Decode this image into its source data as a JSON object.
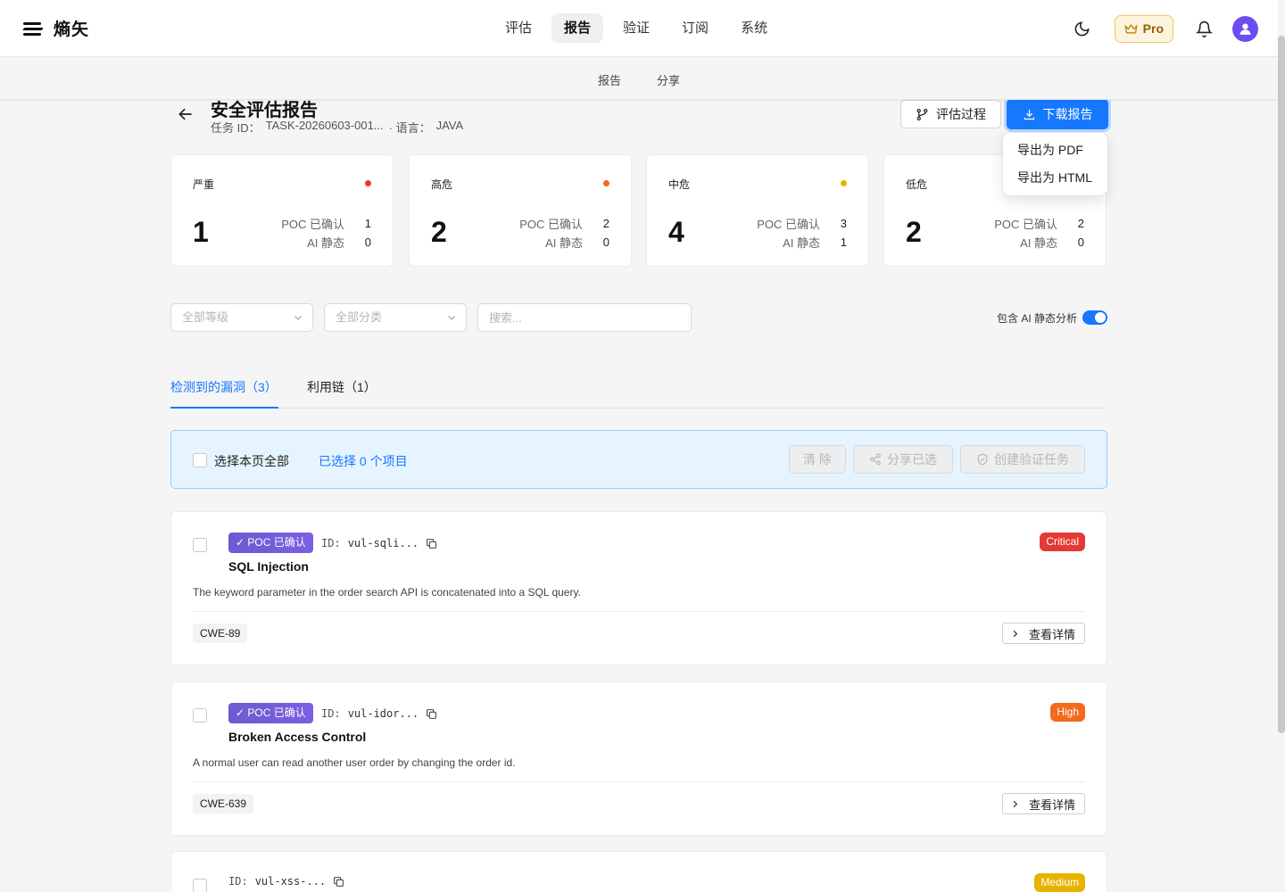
{
  "app": {
    "name": "熵矢",
    "pro_label": "Pro"
  },
  "nav": {
    "items": [
      "评估",
      "报告",
      "验证",
      "订阅",
      "系统"
    ],
    "active": 1
  },
  "subnav": {
    "items": [
      "报告",
      "分享"
    ]
  },
  "header": {
    "title": "安全评估报告",
    "task_label": "任务 ID：",
    "task_value": "TASK-20260603-001...",
    "lang_label": "· 语言：",
    "lang_value": "JAVA",
    "process_button": "评估过程",
    "download_button": "下载报告"
  },
  "download_menu": [
    "导出为 PDF",
    "导出为 HTML"
  ],
  "stats": [
    {
      "label": "严重",
      "count": "1",
      "poc_label": "POC 已确认",
      "poc": "1",
      "ai_label": "AI 静态",
      "ai": "0",
      "color": "#e53935"
    },
    {
      "label": "高危",
      "count": "2",
      "poc_label": "POC 已确认",
      "poc": "2",
      "ai_label": "AI 静态",
      "ai": "0",
      "color": "#f26b1d"
    },
    {
      "label": "中危",
      "count": "4",
      "poc_label": "POC 已确认",
      "poc": "3",
      "ai_label": "AI 静态",
      "ai": "1",
      "color": "#e6b400"
    },
    {
      "label": "低危",
      "count": "2",
      "poc_label": "POC 已确认",
      "poc": "2",
      "ai_label": "AI 静态",
      "ai": "0",
      "color": "#4caf50"
    }
  ],
  "filters": {
    "level_placeholder": "全部等级",
    "category_placeholder": "全部分类",
    "search_placeholder": "搜索...",
    "ai_toggle_label": "包含 AI 静态分析",
    "ai_toggle_on": true
  },
  "tabs": [
    "检测到的漏洞（3）",
    "利用链（1）"
  ],
  "selection": {
    "select_all": "选择本页全部",
    "count": "已选择 0 个项目",
    "clear": "清 除",
    "share": "分享已选",
    "verify": "创建验证任务"
  },
  "vulns": [
    {
      "poc": "✓ POC 已确认",
      "id_label": "ID:",
      "id": "vul-sqli...",
      "title": "SQL Injection",
      "desc": "The keyword parameter in the order search API is concatenated into a SQL query.",
      "cwe": "CWE-89",
      "severity": "Critical",
      "sev_color": "#e53935",
      "detail": "查看详情"
    },
    {
      "poc": "✓ POC 已确认",
      "id_label": "ID:",
      "id": "vul-idor...",
      "title": "Broken Access Control",
      "desc": "A normal user can read another user order by changing the order id.",
      "cwe": "CWE-639",
      "severity": "High",
      "sev_color": "#f26b1d",
      "detail": "查看详情"
    },
    {
      "id_label": "ID:",
      "id": "vul-xss-...",
      "severity": "Medium",
      "sev_color": "#e6b400"
    }
  ]
}
